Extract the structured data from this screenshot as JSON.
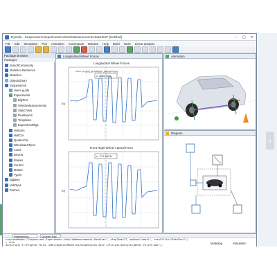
{
  "window": {
    "title": "Dymola - Suspensions.Experiments.VehicleMeasurements.DataTest* [Untitled]",
    "controls": [
      "–",
      "▢",
      "✕"
    ]
  },
  "menu": [
    "File",
    "Edit",
    "Simulation",
    "Plot",
    "Animation",
    "Commands",
    "Window",
    "Help",
    "Build",
    "Tools",
    "Linear analysis"
  ],
  "package_browser": {
    "title": "Package Browser",
    "subheader": "Packages",
    "items": [
      {
        "label": "SymoltCommunity",
        "indent": 0,
        "color": "#3a6fb0"
      },
      {
        "label": "Modelica Reference",
        "indent": 0,
        "color": "#3a6fb0"
      },
      {
        "label": "Modelica",
        "indent": 0,
        "color": "#3a6fb0"
      },
      {
        "label": "ObjectLibrary",
        "indent": 0,
        "color": "#9aa6b6"
      },
      {
        "label": "Suspensions",
        "indent": 0,
        "color": "#3a6fb0"
      },
      {
        "label": "Users guide",
        "indent": 1,
        "color": "#6a9fd8"
      },
      {
        "label": "Experiments",
        "indent": 1,
        "color": "#5aa469"
      },
      {
        "label": "BigTest",
        "indent": 2,
        "color": "#9aa6b6"
      },
      {
        "label": "VehicleMeasurements",
        "indent": 2,
        "color": "#9aa6b6"
      },
      {
        "label": "StaticTests",
        "indent": 2,
        "color": "#9aa6b6"
      },
      {
        "label": "FlexBeams",
        "indent": 2,
        "color": "#9aa6b6"
      },
      {
        "label": "Templates",
        "indent": 2,
        "color": "#9aa6b6"
      },
      {
        "label": "ExperimentRigs",
        "indent": 2,
        "color": "#9aa6b6"
      },
      {
        "label": "Vehicles",
        "indent": 1,
        "color": "#3a6fb0"
      },
      {
        "label": "HalfCar",
        "indent": 1,
        "color": "#3a6fb0"
      },
      {
        "label": "QuarterCar",
        "indent": 1,
        "color": "#3a6fb0"
      },
      {
        "label": "WheelsandTyres",
        "indent": 1,
        "color": "#3a6fb0"
      },
      {
        "label": "Axels",
        "indent": 1,
        "color": "#3a6fb0"
      },
      {
        "label": "Drivers",
        "indent": 1,
        "color": "#3a6fb0"
      },
      {
        "label": "Brakes",
        "indent": 1,
        "color": "#3a6fb0"
      },
      {
        "label": "Control",
        "indent": 1,
        "color": "#3a6fb0"
      },
      {
        "label": "Motors",
        "indent": 1,
        "color": "#3a6fb0"
      },
      {
        "label": "Types",
        "indent": 1,
        "color": "#3a6fb0"
      },
      {
        "label": "DlgBets",
        "indent": 0,
        "color": "#3a6fb0"
      },
      {
        "label": "VehDyns",
        "indent": 0,
        "color": "#3a6fb0"
      },
      {
        "label": "Frames",
        "indent": 0,
        "color": "#3a6fb0"
      }
    ]
  },
  "plot_window": {
    "title": "Longitudinal Wheel Forces",
    "top_plot": {
      "title": "Longitudinal Wheel Forces",
      "legend": "Front Left Wheel Lateral Force",
      "cursor_readout": "x: 4656.94 N",
      "ylabel": "[N]"
    },
    "bottom_plot": {
      "title": "Front Right Wheel Lateral Force",
      "cursor_readout": "x: -717.363 N",
      "ylabel": "[N]"
    }
  },
  "animation": {
    "title": "Animation"
  },
  "diagram": {
    "title": "Diagram"
  },
  "bottom_panel": {
    "selector": "Preferences",
    "selector2": "Quarter Rail",
    "commands": [
      "simulateModel(\"Suspensions.Experiments.VehicleMeasurements.DataTest\", stopTime=27, method=\"dassl\", resultFile=\"DataTest\");",
      "= true",
      "RunScript(\"C:/Program Files (x86)/Dymola/Modelica/Suspensions 2017.1/Scripts/Analysis/Wheel Forces.mos\");"
    ],
    "mode_modeling": "Modeling",
    "mode_simulation": "Simulation"
  },
  "nav": {
    "next_arrow": "›"
  }
}
